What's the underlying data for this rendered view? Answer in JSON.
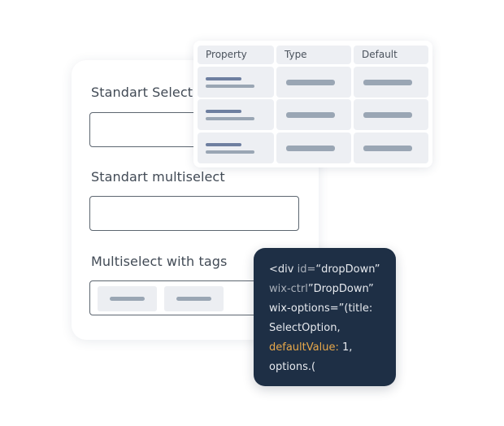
{
  "form": {
    "fields": [
      {
        "label": "Standart Select",
        "value": ""
      },
      {
        "label": "Standart multiselect",
        "value": ""
      },
      {
        "label": "Multiselect with tags",
        "tags": [
          "tag-placeholder",
          "tag-placeholder"
        ]
      }
    ]
  },
  "props_table": {
    "headers": [
      "Property",
      "Type",
      "Default"
    ],
    "rows": [
      [
        "text-placeholder",
        "text-placeholder",
        "text-placeholder"
      ],
      [
        "text-placeholder",
        "text-placeholder",
        "text-placeholder"
      ],
      [
        "text-placeholder",
        "text-placeholder",
        "text-placeholder"
      ]
    ]
  },
  "code": {
    "lines": [
      [
        {
          "t": "<div ",
          "c": "plain"
        },
        {
          "t": "id=",
          "c": "attr"
        },
        {
          "t": "“dropDown”",
          "c": "plain"
        }
      ],
      [
        {
          "t": "wix-ctrl",
          "c": "attr"
        },
        {
          "t": "”DropDown”",
          "c": "plain"
        }
      ],
      [
        {
          "t": "wix-options=”(title:",
          "c": "plain"
        }
      ],
      [
        {
          "t": "SelectOption,",
          "c": "plain"
        }
      ],
      [
        {
          "t": "defaultValue:",
          "c": "key"
        },
        {
          "t": " 1,",
          "c": "plain"
        }
      ],
      [
        {
          "t": "options.(",
          "c": "plain"
        }
      ]
    ]
  },
  "colors": {
    "code_bg": "#1e2f45",
    "code_keyword": "#e8a84a",
    "placeholder_dark": "#6e7fa0",
    "placeholder_light": "#9aa6b4",
    "cell_bg": "#edeff3"
  }
}
